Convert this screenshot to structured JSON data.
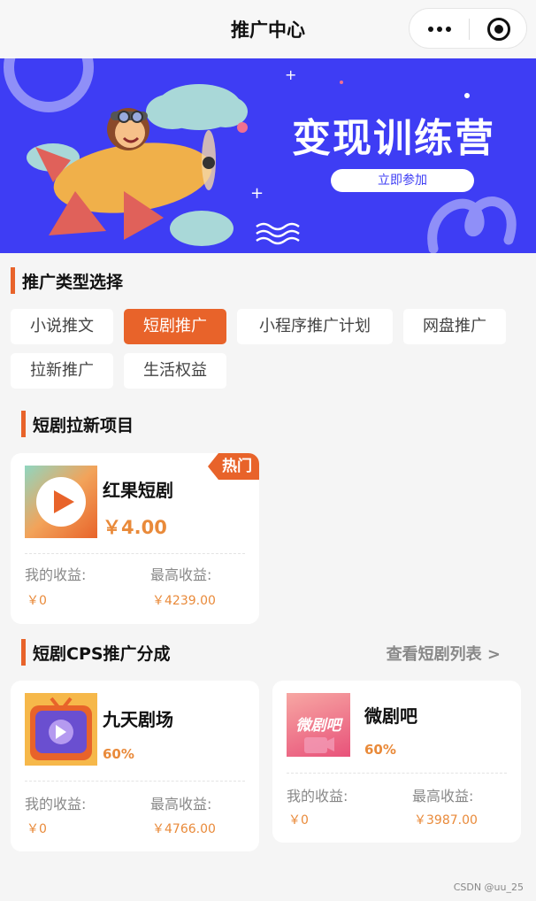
{
  "header": {
    "title": "推广中心",
    "more_icon": "more-dots-icon",
    "close_icon": "target-circle-icon"
  },
  "banner": {
    "title": "变现训练营",
    "button_label": "立即参加"
  },
  "promo_types": {
    "title": "推广类型选择",
    "chips": [
      {
        "label": "小说推文",
        "active": false
      },
      {
        "label": "短剧推广",
        "active": true
      },
      {
        "label": "小程序推广计划",
        "active": false
      },
      {
        "label": "网盘推广",
        "active": false
      },
      {
        "label": "拉新推广",
        "active": false
      },
      {
        "label": "生活权益",
        "active": false
      }
    ]
  },
  "pull_new": {
    "title": "短剧拉新项目",
    "items": [
      {
        "name": "红果短剧",
        "price": "￥4.00",
        "badge": "热门",
        "my_income_label": "我的收益:",
        "my_income": "￥0",
        "max_income_label": "最高收益:",
        "max_income": "￥4239.00"
      }
    ]
  },
  "cps": {
    "title": "短剧CPS推广分成",
    "more_link": "查看短剧列表 >",
    "items": [
      {
        "name": "九天剧场",
        "percent": "60%",
        "my_income_label": "我的收益:",
        "my_income": "￥0",
        "max_income_label": "最高收益:",
        "max_income": "￥4766.00"
      },
      {
        "name": "微剧吧",
        "percent": "60%",
        "logo_text": "微剧吧",
        "my_income_label": "我的收益:",
        "my_income": "￥0",
        "max_income_label": "最高收益:",
        "max_income": "￥3987.00"
      }
    ]
  },
  "watermark": "CSDN @uu_25",
  "colors": {
    "accent": "#e8632a",
    "banner_bg": "#3e3df4",
    "value_orange": "#e98a3a"
  }
}
